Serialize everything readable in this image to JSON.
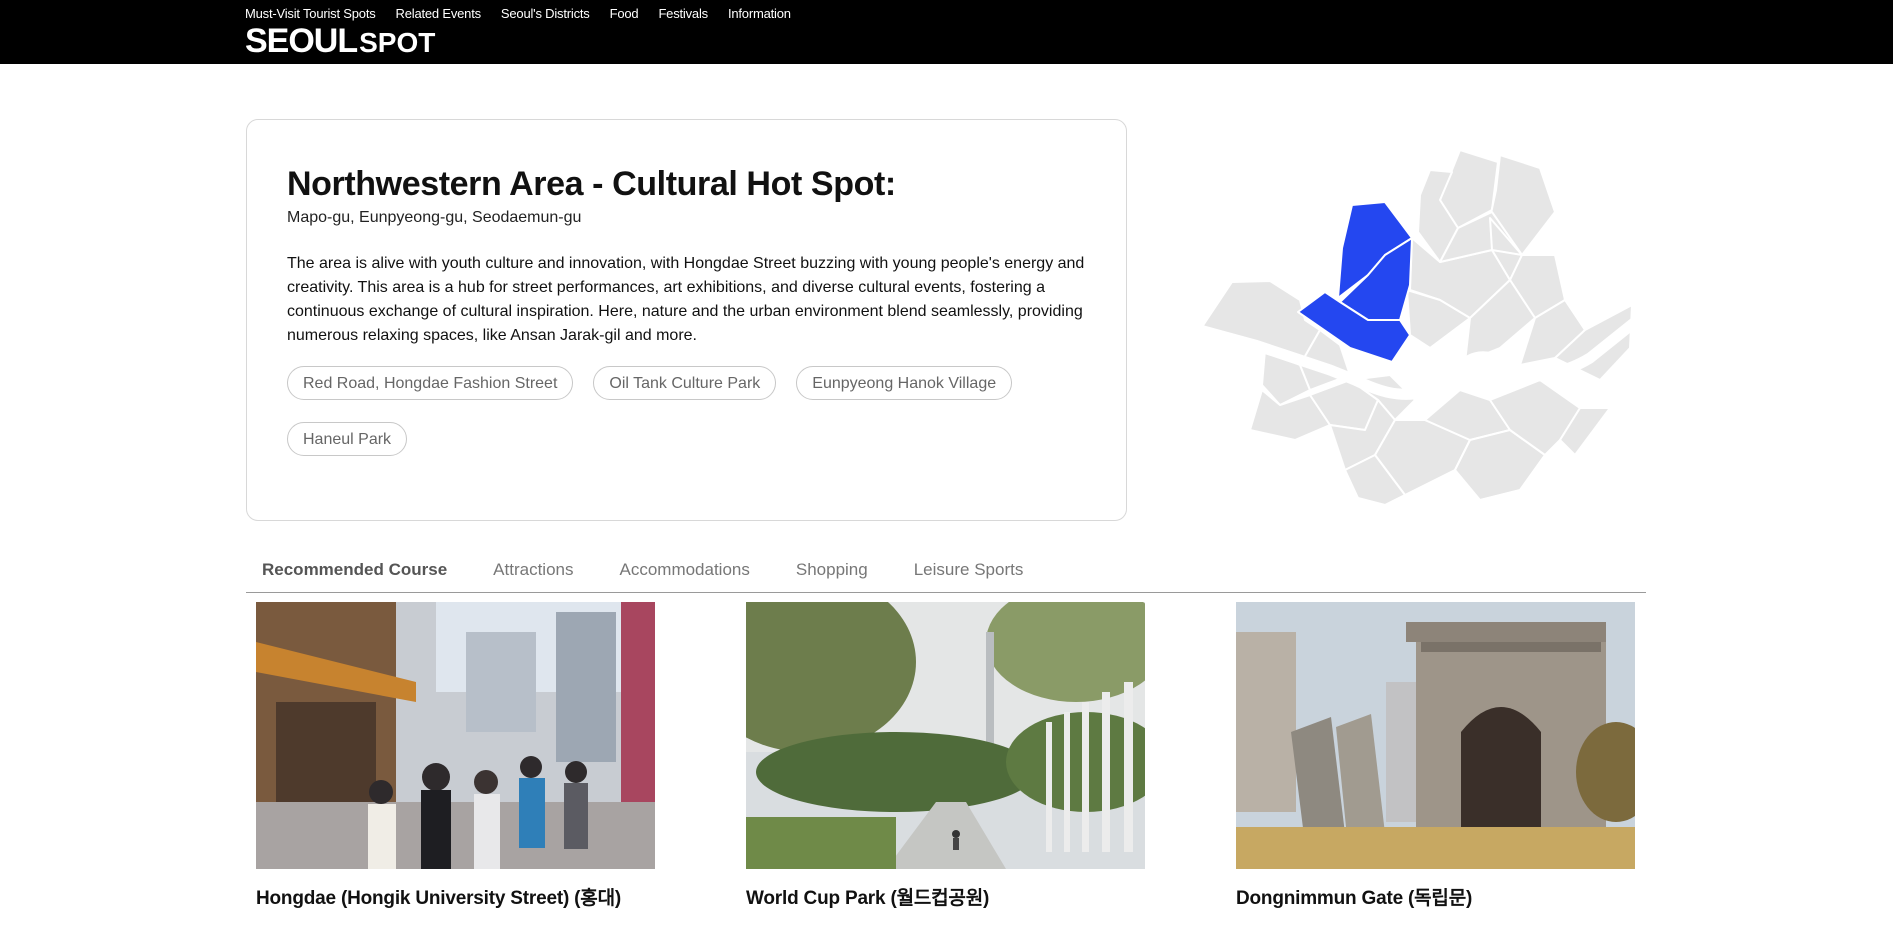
{
  "nav": {
    "items": [
      "Must-Visit Tourist Spots",
      "Related Events",
      "Seoul's Districts",
      "Food",
      "Festivals",
      "Information"
    ]
  },
  "logo": {
    "primary": "SEOUL",
    "secondary": "SPOT"
  },
  "area": {
    "title": "Northwestern Area - Cultural Hot Spot:",
    "districts": "Mapo-gu, Eunpyeong-gu, Seodaemun-gu",
    "description": "The area is alive with youth culture and innovation, with Hongdae Street buzzing with young people's energy and creativity. This area is a hub for street performances, art exhibitions, and diverse cultural events, fostering a continuous exchange of cultural inspiration. Here, nature and the urban environment blend seamlessly, providing numerous relaxing spaces, like Ansan Jarak-gil and more.",
    "tags": [
      "Red Road, Hongdae Fashion Street",
      "Oil Tank Culture Park",
      "Eunpyeong Hanok Village",
      "Haneul Park"
    ]
  },
  "map": {
    "highlight_color": "#2447f0",
    "base_color": "#e6e6e6",
    "river_color": "#ffffff"
  },
  "tabs": [
    "Recommended Course",
    "Attractions",
    "Accommodations",
    "Shopping",
    "Leisure Sports"
  ],
  "courses": [
    {
      "name": "Hongdae (Hongik University Street) (홍대)"
    },
    {
      "name": "World Cup Park (월드컵공원)"
    },
    {
      "name": "Dongnimmun Gate (독립문)"
    }
  ]
}
